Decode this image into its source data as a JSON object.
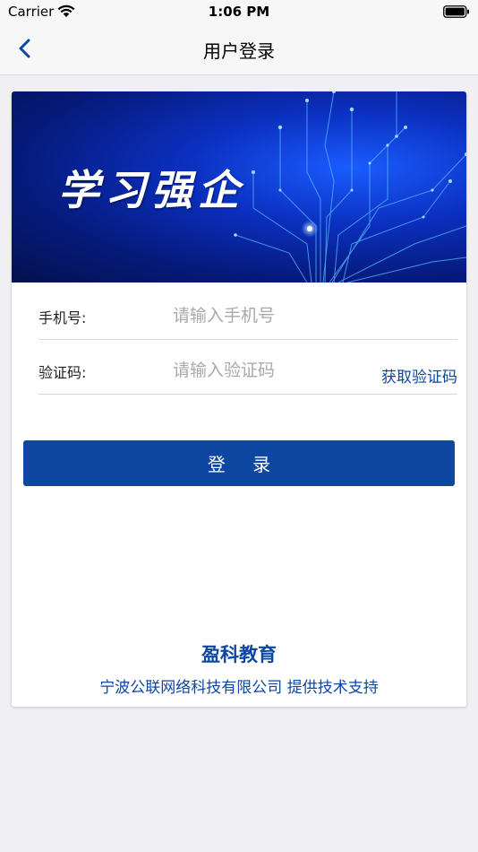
{
  "status_bar": {
    "carrier": "Carrier",
    "time": "1:06 PM",
    "icons": [
      "wifi-icon",
      "battery-icon"
    ]
  },
  "nav": {
    "title": "用户登录",
    "back_icon": "chevron-left-icon"
  },
  "banner": {
    "title": "学习强企"
  },
  "form": {
    "phone": {
      "label": "手机号:",
      "placeholder": "请输入手机号",
      "value": ""
    },
    "code": {
      "label": "验证码:",
      "placeholder": "请输入验证码",
      "value": "",
      "get_code_label": "获取验证码"
    },
    "login_label": "登 录"
  },
  "footer": {
    "brand": "盈科教育",
    "support": "宁波公联网络科技有限公司 提供技术支持"
  },
  "colors": {
    "accent": "#0d47a1",
    "background": "#efeff4",
    "nav_bar": "#f7f7f7",
    "placeholder": "#a9a9a9"
  }
}
